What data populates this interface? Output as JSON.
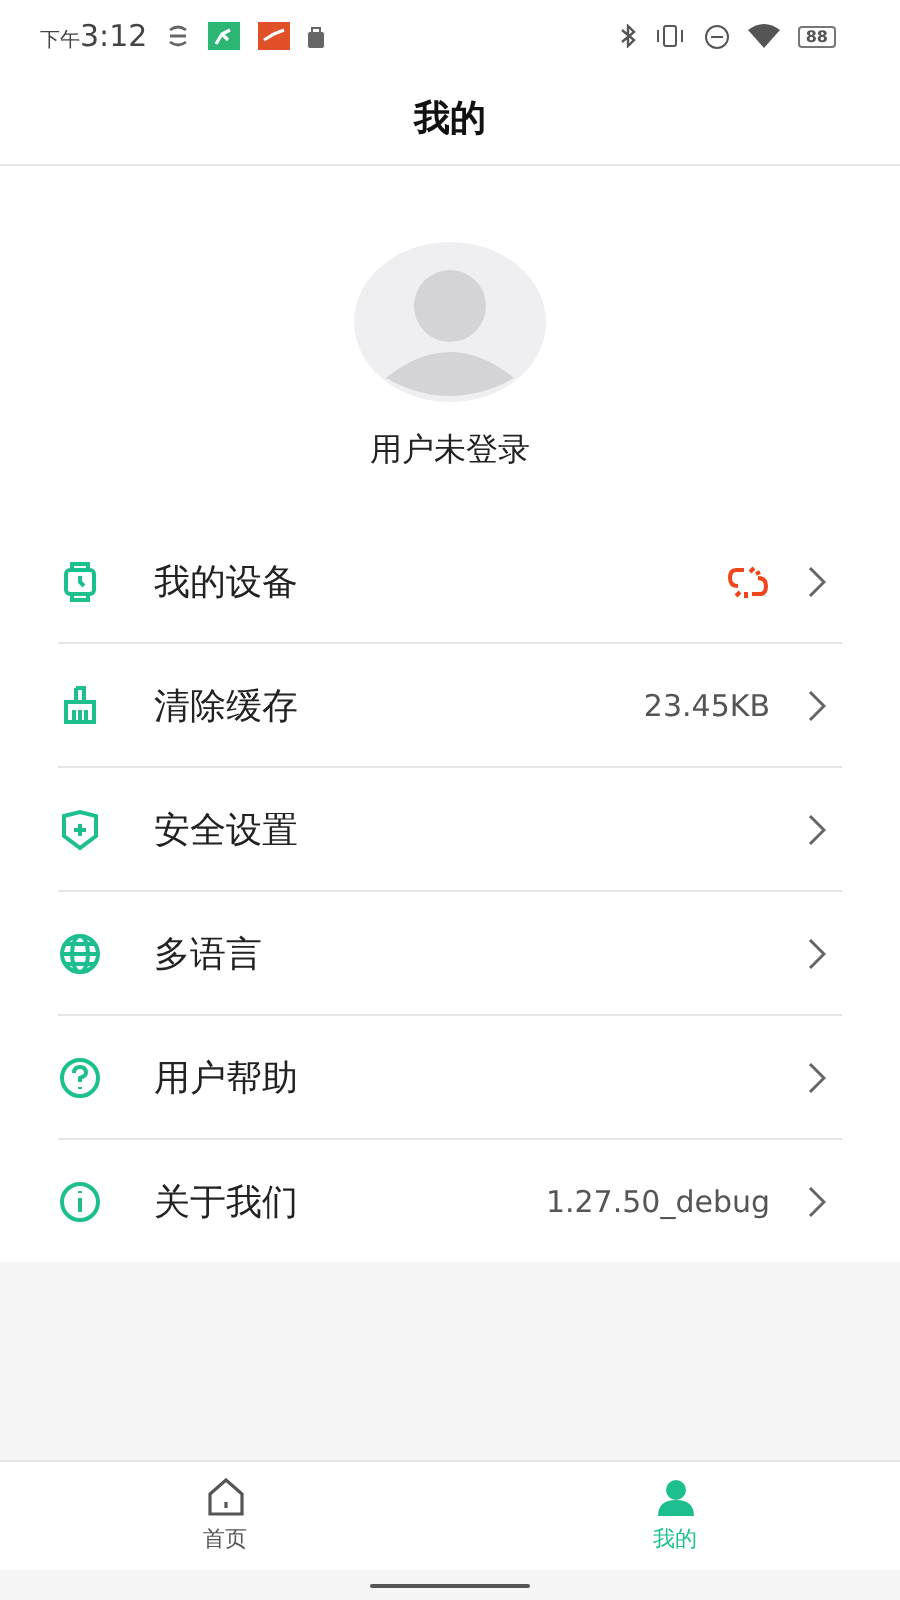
{
  "status_bar": {
    "period": "下午",
    "time": "3:12",
    "battery": "88"
  },
  "header": {
    "title": "我的"
  },
  "profile": {
    "name": "用户未登录"
  },
  "menu": [
    {
      "kind": "watch",
      "label": "我的设备",
      "disconnected": true
    },
    {
      "kind": "broom",
      "label": "清除缓存",
      "value": "23.45KB",
      "disconnected": false
    },
    {
      "kind": "shield",
      "label": "安全设置",
      "disconnected": false
    },
    {
      "kind": "globe",
      "label": "多语言",
      "disconnected": false
    },
    {
      "kind": "help",
      "label": "用户帮助",
      "disconnected": false
    },
    {
      "kind": "info",
      "label": "关于我们",
      "value": "1.27.50_debug",
      "disconnected": false
    }
  ],
  "tabs": [
    {
      "kind": "home",
      "label": "首页",
      "selected": false
    },
    {
      "kind": "user",
      "label": "我的",
      "selected": true
    }
  ]
}
